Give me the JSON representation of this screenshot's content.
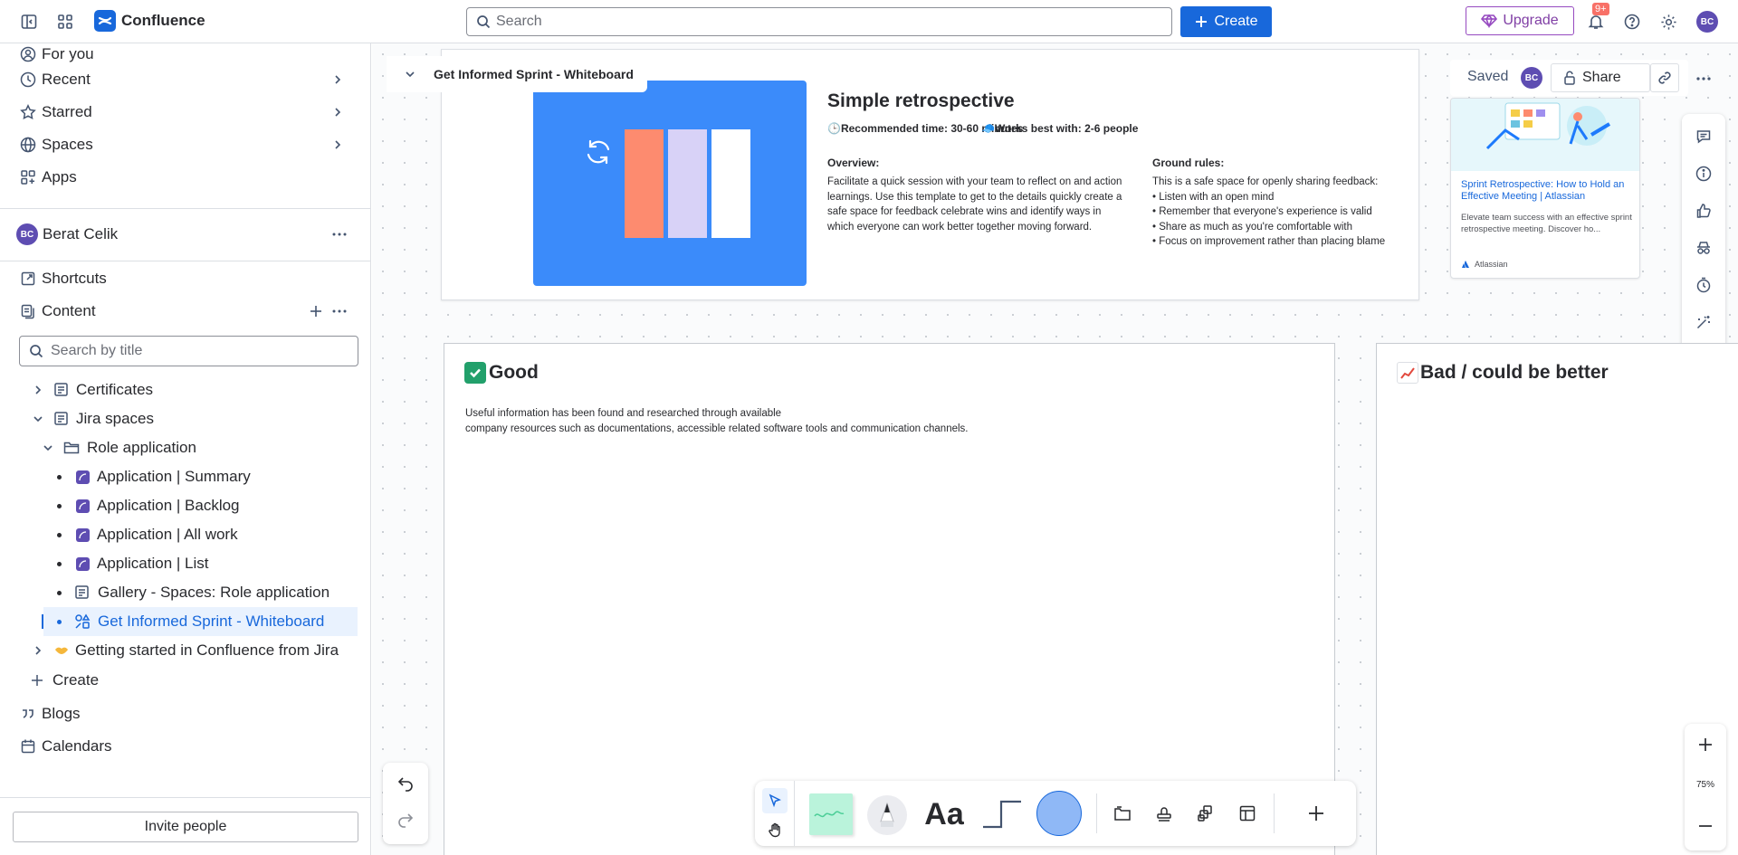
{
  "app": {
    "name": "Confluence"
  },
  "topbar": {
    "search_placeholder": "Search",
    "create_label": "Create",
    "upgrade_label": "Upgrade",
    "notifications_badge": "9+",
    "avatar_initials": "BC"
  },
  "sidebar": {
    "nav": [
      {
        "label": "For you",
        "icon": "user-circle-icon"
      },
      {
        "label": "Recent",
        "icon": "clock-icon"
      },
      {
        "label": "Starred",
        "icon": "star-icon"
      },
      {
        "label": "Spaces",
        "icon": "globe-icon"
      },
      {
        "label": "Apps",
        "icon": "apps-icon"
      }
    ],
    "space": {
      "name": "Berat Celik",
      "initials": "BC"
    },
    "shortcuts_label": "Shortcuts",
    "content_label": "Content",
    "search_placeholder": "Search by title",
    "tree": [
      {
        "label": "Certificates"
      },
      {
        "label": "Jira spaces"
      },
      {
        "label": "Role application"
      },
      {
        "label": "Application | Summary"
      },
      {
        "label": "Application | Backlog"
      },
      {
        "label": "Application | All work"
      },
      {
        "label": "Application | List"
      },
      {
        "label": "Gallery - Spaces: Role application"
      },
      {
        "label": "Get Informed Sprint - Whiteboard"
      },
      {
        "label": "Getting started in Confluence from Jira"
      }
    ],
    "create_label": "Create",
    "blogs_label": "Blogs",
    "calendars_label": "Calendars",
    "invite_label": "Invite people"
  },
  "whiteboard": {
    "title": "Get Informed Sprint - Whiteboard",
    "saved_label": "Saved",
    "share_label": "Share",
    "avatar_initials": "BC",
    "template": {
      "title": "Simple retrospective",
      "recommended_time": "Recommended time: 30-60 minutes",
      "works_best": "Works best with: 2-6 people",
      "overview_heading": "Overview:",
      "overview_text": "Facilitate a quick session with your team to reflect on and action learnings. Use this template to get to the details quickly create a safe space for feedback celebrate wins and identify ways in which everyone can work better together moving forward.",
      "rules_heading": "Ground rules:",
      "rules_intro": "This is a safe space for openly sharing feedback:",
      "rules": [
        "Listen with an open mind",
        "Remember that everyone's experience is valid",
        "Share as much as you're comfortable with",
        "Focus on improvement rather than placing blame"
      ]
    },
    "link_card": {
      "title": "Sprint Retrospective: How to Hold an Effective Meeting | Atlassian",
      "description": "Elevate team success with an effective sprint retrospective meeting. Discover ho...",
      "source": "Atlassian"
    },
    "good_frame": {
      "title": "Good",
      "text_line1": "Useful information has been found and researched through available",
      "text_line2": "company resources such as documentations, accessible related software tools and communication channels."
    },
    "bad_frame": {
      "title": "Bad / could be better"
    },
    "zoom_label": "75%",
    "colors": {
      "accent": "#1868db",
      "hero": "#3b8bfa",
      "bar1": "#fd8b6f",
      "bar2": "#d8d2f7",
      "bar3": "#ffffff",
      "shape": "#8fb8f6"
    }
  }
}
